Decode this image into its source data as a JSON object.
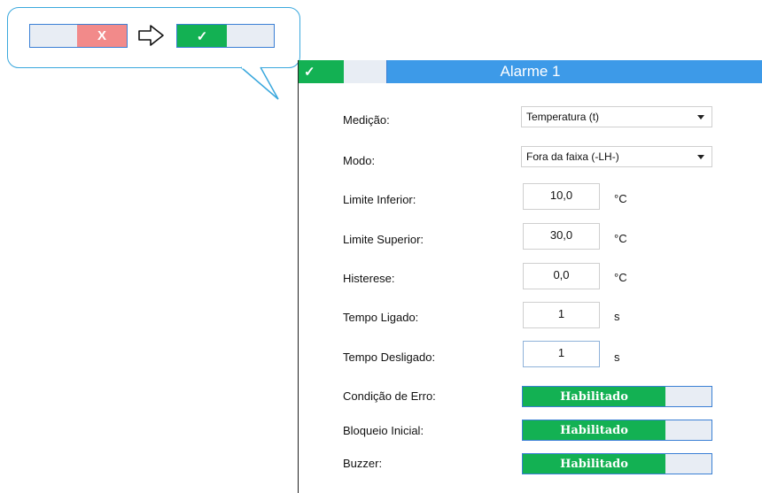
{
  "callout": {
    "before_toggle": {
      "off_glyph": "X"
    },
    "after_toggle": {
      "on_glyph": "✓"
    }
  },
  "panel": {
    "title": "Alarme 1",
    "header_toggle_glyph": "✓"
  },
  "fields": {
    "medicao": {
      "label": "Medição:",
      "value": "Temperatura (t)"
    },
    "modo": {
      "label": "Modo:",
      "value": "Fora da faixa (-LH-)"
    },
    "limite_inferior": {
      "label": "Limite Inferior:",
      "value": "10,0",
      "unit": "°C"
    },
    "limite_superior": {
      "label": "Limite Superior:",
      "value": "30,0",
      "unit": "°C"
    },
    "histerese": {
      "label": "Histerese:",
      "value": "0,0",
      "unit": "°C"
    },
    "tempo_ligado": {
      "label": "Tempo Ligado:",
      "value": "1",
      "unit": "s"
    },
    "tempo_desligado": {
      "label": "Tempo Desligado:",
      "value": "1",
      "unit": "s"
    },
    "condicao_erro": {
      "label": "Condição de Erro:",
      "state": "Habilitado"
    },
    "bloqueio_inicial": {
      "label": "Bloqueio Inicial:",
      "state": "Habilitado"
    },
    "buzzer": {
      "label": "Buzzer:",
      "state": "Habilitado"
    }
  },
  "colors": {
    "header_blue": "#3d9ae8",
    "enabled_green": "#13b153",
    "disabled_red": "#f28a8a",
    "toggle_border": "#3a7fd5",
    "callout_border": "#3aa8dd"
  }
}
